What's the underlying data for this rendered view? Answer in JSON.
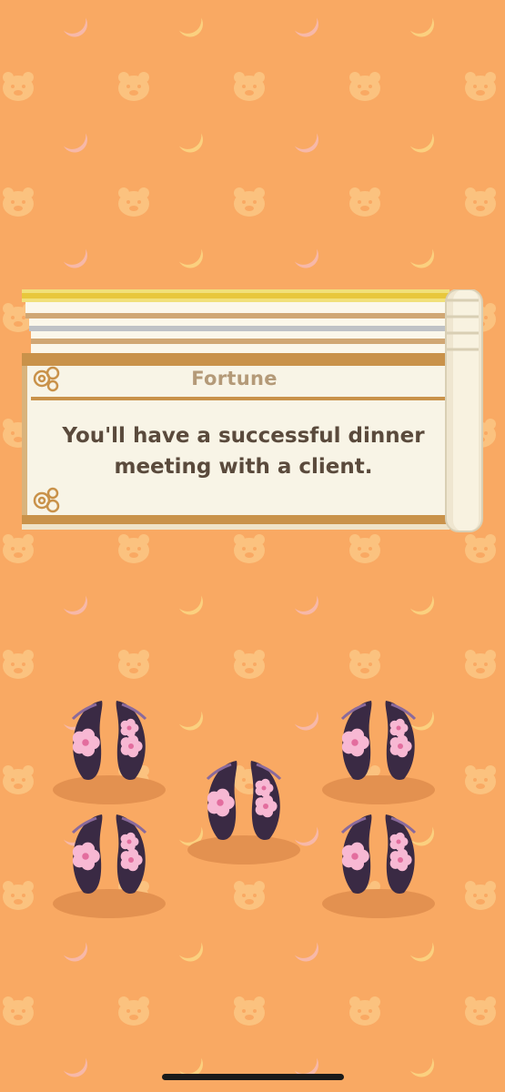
{
  "background": {
    "color": "#f9a963",
    "motif_icons": [
      "bear-face-icon",
      "crescent-moon-icon"
    ]
  },
  "fortune": {
    "title": "Fortune",
    "message_line1": "You'll have a successful dinner",
    "message_line2": "meeting with a client."
  },
  "cookies": {
    "count": 5,
    "icon": "cherry-blossom-fortune-cookie-icon"
  },
  "colors": {
    "cookie": "#3a2a44",
    "blossom": "#f7b8d3",
    "paper": "#f8f4e6",
    "gold": "#c9924a"
  }
}
